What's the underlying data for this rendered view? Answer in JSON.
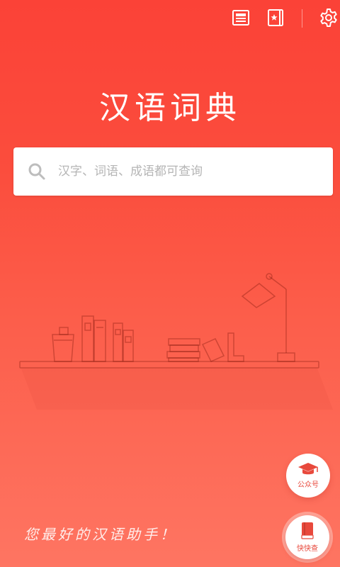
{
  "header": {
    "icons": [
      "news-icon",
      "bookmark-card-icon",
      "settings-gear-icon"
    ]
  },
  "app_title": "汉语词典",
  "search": {
    "placeholder": "汉字、词语、成语都可查询",
    "value": ""
  },
  "illustration": {
    "name": "bookshelf-illustration"
  },
  "fab_official_account": {
    "label": "公众号",
    "icon": "graduation-cap-icon"
  },
  "fab_quick_lookup": {
    "label": "快快查",
    "icon": "book-icon"
  },
  "slogan": "您最好的汉语助手！",
  "colors": {
    "background_top": "#fb4237",
    "background_bottom": "#fe7562",
    "accent": "#e8493c",
    "white": "#ffffff"
  }
}
